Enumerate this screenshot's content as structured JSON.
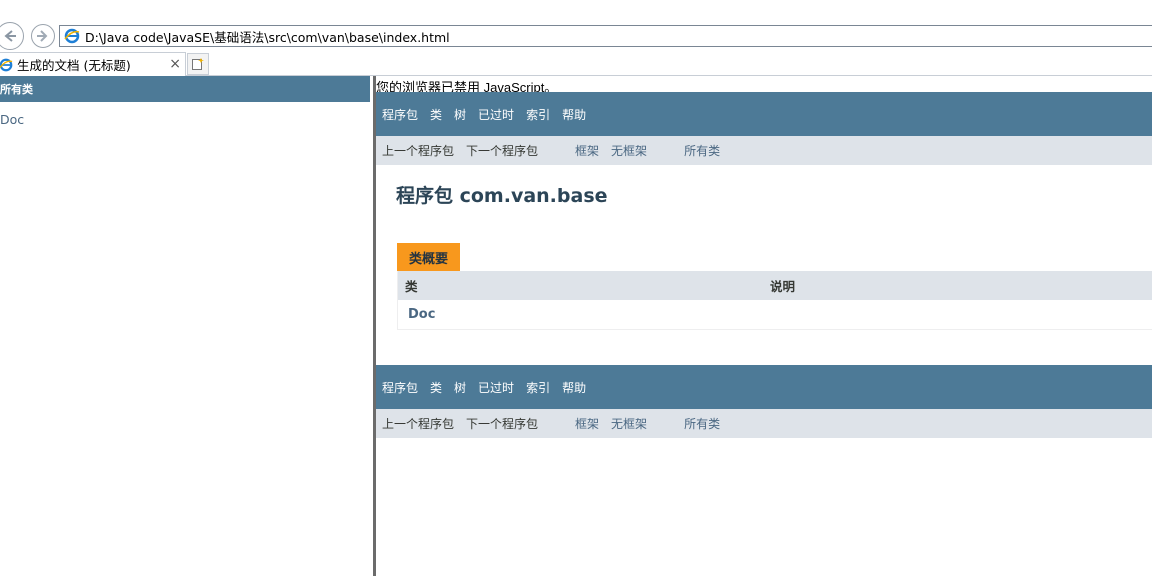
{
  "browser": {
    "address": "D:\\Java code\\JavaSE\\基础语法\\src\\com\\van\\base\\index.html",
    "tab_title": "生成的文档 (无标题)",
    "tab_close": "×"
  },
  "left_frame": {
    "header": "所有类",
    "classes": [
      "Doc"
    ]
  },
  "right_frame": {
    "noscript": "您的浏览器已禁用 JavaScript。",
    "top_nav": {
      "items": [
        "程序包",
        "类",
        "树",
        "已过时",
        "索引",
        "帮助"
      ],
      "sub_prev": "上一个程序包",
      "sub_next": "下一个程序包",
      "sub_frames": "框架",
      "sub_noframes": "无框架",
      "sub_allclasses": "所有类"
    },
    "bottom_nav": {
      "items": [
        "程序包",
        "类",
        "树",
        "已过时",
        "索引",
        "帮助"
      ],
      "sub_prev": "上一个程序包",
      "sub_next": "下一个程序包",
      "sub_frames": "框架",
      "sub_noframes": "无框架",
      "sub_allclasses": "所有类"
    },
    "package_title": "程序包 com.van.base",
    "summary": {
      "caption": "类概要",
      "col_class": "类",
      "col_desc": "说明",
      "rows": [
        {
          "class": "Doc",
          "desc": ""
        }
      ]
    }
  },
  "colors": {
    "nav_bar": "#4d7a97",
    "sub_nav": "#dee3e9",
    "caption_tab": "#f8981d",
    "link": "#4a6782"
  }
}
